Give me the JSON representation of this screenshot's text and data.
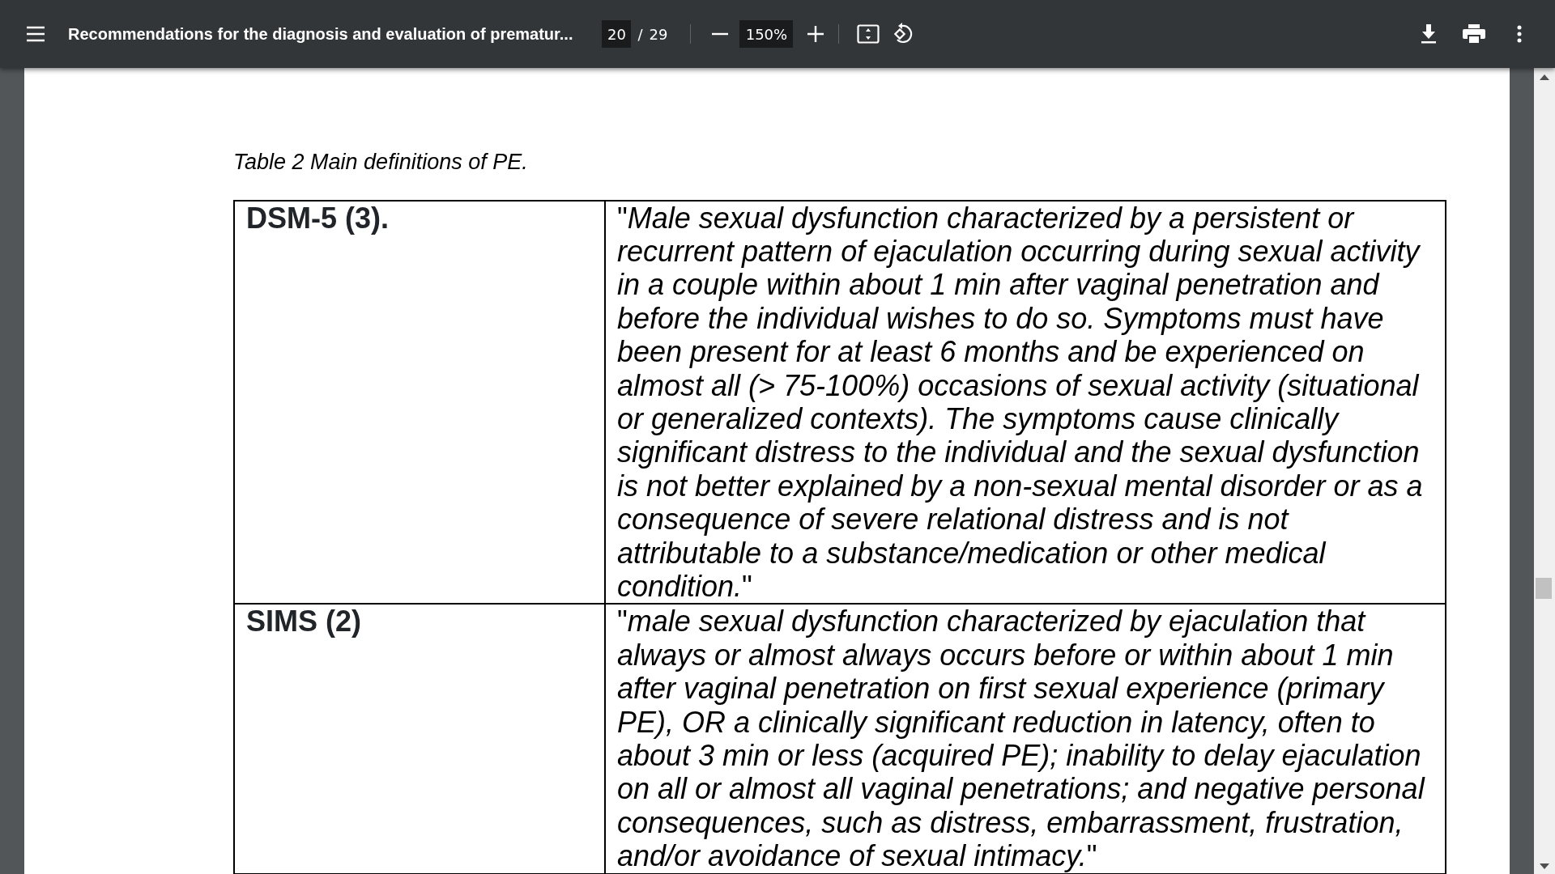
{
  "toolbar": {
    "title": "Recommendations for the diagnosis and evaluation of prematur...",
    "page_current": "20",
    "page_separator": "/",
    "page_total": "29",
    "zoom": "150%"
  },
  "document": {
    "caption": "Table 2 Main definitions of PE.",
    "rows": [
      {
        "term": "DSM-5 (3).",
        "definition": "\"*Male sexual dysfunction characterized by a persistent or recurrent pattern of ejaculation occurring during sexual activity in a couple within about 1 min after vaginal penetration and before the individual wishes to do so. Symptoms must have been present for at least 6 months and be experienced on almost all (> 75-100%) occasions of sexual activity (situational or generalized contexts). The symptoms cause clinically significant distress to the individual and the sexual dysfunction is not better explained by a non-sexual mental disorder or as a consequence of severe relational distress and is not attributable to a substance/medication or other medical condition.*\""
      },
      {
        "term": "SIMS (2)",
        "definition": "\"*male sexual dysfunction characterized by ejaculation that always or almost always occurs before or within about 1 min after vaginal penetration on first sexual experience (primary PE), OR a clinically significant reduction in latency, often to about 3 min or less (acquired PE); inability to delay ejaculation on all or almost all vaginal penetrations; and negative personal consequences, such as distress, embarrassment, frustration, and/or avoidance of sexual intimacy.*\""
      }
    ]
  }
}
